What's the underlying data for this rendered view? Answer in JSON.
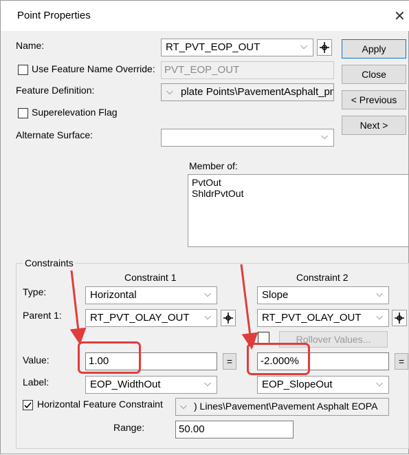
{
  "window": {
    "title": "Point Properties"
  },
  "general": {
    "name_label": "Name:",
    "name_value": "RT_PVT_EOP_OUT",
    "override_label": "Use Feature Name Override:",
    "override_value": "PVT_EOP_OUT",
    "feature_def_label": "Feature Definition:",
    "feature_def_value": "plate Points\\PavementAsphalt_pm",
    "superelevation_label": "Superelevation Flag",
    "alternate_surface_label": "Alternate Surface:",
    "alternate_surface_value": "",
    "member_of_label": "Member of:",
    "member_of_items": [
      "PvtOut",
      "ShldrPvtOut"
    ]
  },
  "buttons": {
    "apply": "Apply",
    "close": "Close",
    "previous": "< Previous",
    "next": "Next >"
  },
  "constraints": {
    "group_label": "Constraints",
    "col1_header": "Constraint 1",
    "col2_header": "Constraint 2",
    "type_label": "Type:",
    "parent_label": "Parent 1:",
    "value_label": "Value:",
    "label_label": "Label:",
    "c1": {
      "type": "Horizontal",
      "parent": "RT_PVT_OLAY_OUT",
      "value": "1.00",
      "label": "EOP_WidthOut"
    },
    "c2": {
      "type": "Slope",
      "parent": "RT_PVT_OLAY_OUT",
      "value": "-2.000%",
      "label": "EOP_SlopeOut",
      "rollover": "Rollover Values..."
    },
    "equals": "=",
    "hfc_label": "Horizontal Feature Constraint",
    "hfc_value": ") Lines\\Pavement\\Pavement Asphalt EOPA",
    "range_label": "Range:",
    "range_value": "50.00"
  },
  "accent_colors": {
    "annotation": "#e03c3c",
    "focus": "#0078d7"
  }
}
